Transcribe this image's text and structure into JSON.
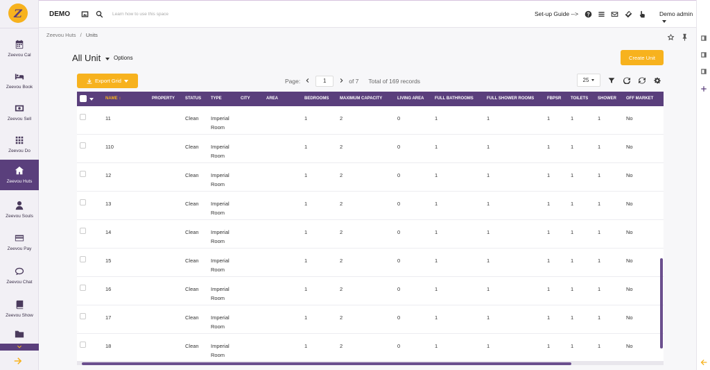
{
  "app": {
    "brand": "DEMO",
    "search_placeholder": "Learn how to use this space",
    "setup_label": "Set-up Guide -->",
    "user_label": "Demo admin"
  },
  "sidebar": {
    "items": [
      {
        "label": "Zeevou Cal",
        "icon": "calendar-icon"
      },
      {
        "label": "Zeevou Book",
        "icon": "bed-icon"
      },
      {
        "label": "Zeevou Sell",
        "icon": "money-icon"
      },
      {
        "label": "Zeevou Do",
        "icon": "grid-icon"
      },
      {
        "label": "Zeevou Huts",
        "icon": "home-icon"
      },
      {
        "label": "Zeevou Souls",
        "icon": "user-icon"
      },
      {
        "label": "Zeevou Pay",
        "icon": "credit-card-icon"
      },
      {
        "label": "Zeevou Chat",
        "icon": "chat-icon"
      },
      {
        "label": "Zeevou Show",
        "icon": "book-icon"
      }
    ],
    "active": "Zeevou Huts"
  },
  "breadcrumb": {
    "root": "Zeevou Huts",
    "sep": "/",
    "current": "Units"
  },
  "page": {
    "title": "All Unit",
    "options_label": "Options",
    "create_label": "Create Unit",
    "export_label": "Export Grid"
  },
  "pager": {
    "page_label": "Page:",
    "current": "1",
    "of_label": "of 7",
    "total_label": "Total of 169 records",
    "per_page": "25"
  },
  "columns": [
    "Name",
    "Property",
    "Status",
    "Type",
    "City",
    "Area",
    "Bedrooms",
    "Maximum Capacity",
    "Living Area",
    "Full Bathrooms",
    "Full Shower Rooms",
    "FBPSR",
    "Toilets",
    "Shower",
    "Off Market"
  ],
  "sort_indicator": "↕",
  "rows": [
    {
      "name": "11",
      "status": "Clean",
      "type1": "Imperial",
      "type2": "Room",
      "bedrooms": "1",
      "capacity": "2",
      "living": "0",
      "fullbath": "1",
      "fullshower": "1",
      "fbpsr": "1",
      "toilets": "1",
      "shower": "1",
      "offmarket": "No"
    },
    {
      "name": "110",
      "status": "Clean",
      "type1": "Imperial",
      "type2": "Room",
      "bedrooms": "1",
      "capacity": "2",
      "living": "0",
      "fullbath": "1",
      "fullshower": "1",
      "fbpsr": "1",
      "toilets": "1",
      "shower": "1",
      "offmarket": "No"
    },
    {
      "name": "12",
      "status": "Clean",
      "type1": "Imperial",
      "type2": "Room",
      "bedrooms": "1",
      "capacity": "2",
      "living": "0",
      "fullbath": "1",
      "fullshower": "1",
      "fbpsr": "1",
      "toilets": "1",
      "shower": "1",
      "offmarket": "No"
    },
    {
      "name": "13",
      "status": "Clean",
      "type1": "Imperial",
      "type2": "Room",
      "bedrooms": "1",
      "capacity": "2",
      "living": "0",
      "fullbath": "1",
      "fullshower": "1",
      "fbpsr": "1",
      "toilets": "1",
      "shower": "1",
      "offmarket": "No"
    },
    {
      "name": "14",
      "status": "Clean",
      "type1": "Imperial",
      "type2": "Room",
      "bedrooms": "1",
      "capacity": "2",
      "living": "0",
      "fullbath": "1",
      "fullshower": "1",
      "fbpsr": "1",
      "toilets": "1",
      "shower": "1",
      "offmarket": "No"
    },
    {
      "name": "15",
      "status": "Clean",
      "type1": "Imperial",
      "type2": "Room",
      "bedrooms": "1",
      "capacity": "2",
      "living": "0",
      "fullbath": "1",
      "fullshower": "1",
      "fbpsr": "1",
      "toilets": "1",
      "shower": "1",
      "offmarket": "No"
    },
    {
      "name": "16",
      "status": "Clean",
      "type1": "Imperial",
      "type2": "Room",
      "bedrooms": "1",
      "capacity": "2",
      "living": "0",
      "fullbath": "1",
      "fullshower": "1",
      "fbpsr": "1",
      "toilets": "1",
      "shower": "1",
      "offmarket": "No"
    },
    {
      "name": "17",
      "status": "Clean",
      "type1": "Imperial",
      "type2": "Room",
      "bedrooms": "1",
      "capacity": "2",
      "living": "0",
      "fullbath": "1",
      "fullshower": "1",
      "fbpsr": "1",
      "toilets": "1",
      "shower": "1",
      "offmarket": "No"
    },
    {
      "name": "18",
      "status": "Clean",
      "type1": "Imperial",
      "type2": "Room",
      "bedrooms": "1",
      "capacity": "2",
      "living": "0",
      "fullbath": "1",
      "fullshower": "1",
      "fbpsr": "1",
      "toilets": "1",
      "shower": "1",
      "offmarket": "No"
    }
  ],
  "colors": {
    "primary": "#5a3f7c",
    "accent": "#f7b21e"
  }
}
